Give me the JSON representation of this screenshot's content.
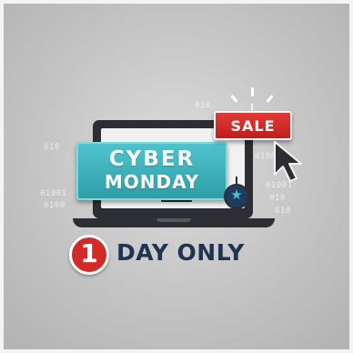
{
  "banner": {
    "line1": "CYBER",
    "line2": "MONDAY"
  },
  "sale_tag": {
    "label": "SALE"
  },
  "promo": {
    "number": "1",
    "text": "DAY ONLY"
  },
  "binary_digits": [
    "010",
    "01001",
    "0100",
    "010",
    "01001",
    "010",
    "010",
    "0100"
  ],
  "colors": {
    "background": "#c4c4c4",
    "banner_teal": "#3eb3bc",
    "sale_red": "#d22a26",
    "laptop_dark": "#2c2e33",
    "text_navy": "#1f3353"
  },
  "icons": [
    "laptop-icon",
    "cursor-arrow-icon",
    "ornament-star-icon",
    "sparkle-icon"
  ]
}
